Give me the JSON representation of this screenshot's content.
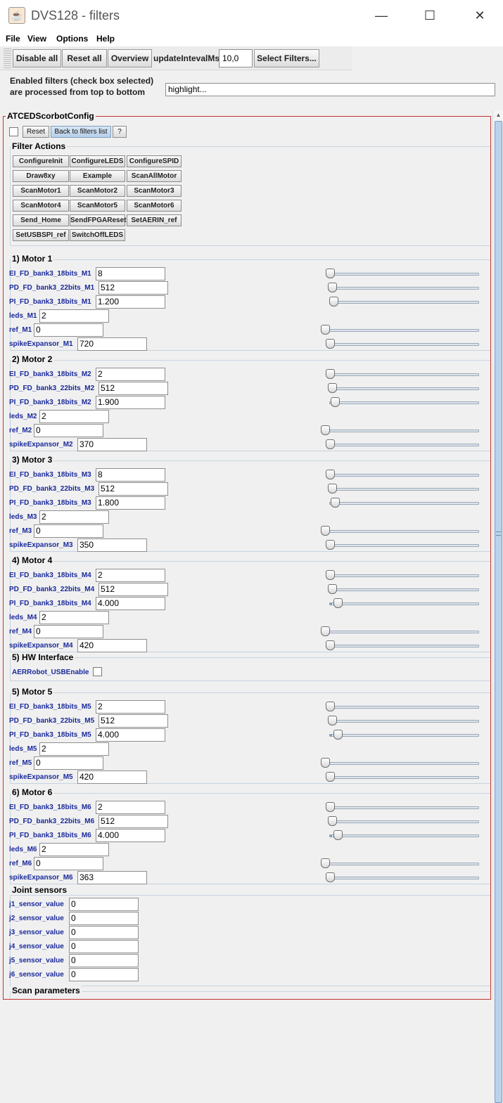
{
  "window": {
    "title": "DVS128 - filters",
    "minimize_glyph": "—",
    "maximize_glyph": "☐",
    "close_glyph": "✕",
    "app_icon": "java-cup-icon"
  },
  "menu": [
    "File",
    "View",
    "Options",
    "Help"
  ],
  "toolbar": {
    "disable_all": "Disable all",
    "reset_all": "Reset  all",
    "overview": "Overview",
    "update_label": "updateIntevalMs",
    "update_value": "10,0",
    "select_filters": "Select Filters..."
  },
  "info": {
    "line1": "Enabled filters (check box selected)",
    "line2": "are processed from top to bottom",
    "highlight_value": "highlight..."
  },
  "filter": {
    "name": "ATCEDScorbotConfig",
    "reset": "Reset",
    "back": "Back to filters list",
    "help": "?",
    "actions_title": "Filter Actions",
    "actions": [
      "ConfigureInit",
      "ConfigureLEDS",
      "ConfigureSPID",
      "Draw8xy",
      "Example",
      "ScanAllMotor",
      "ScanMotor1",
      "ScanMotor2",
      "ScanMotor3",
      "ScanMotor4",
      "ScanMotor5",
      "ScanMotor6",
      "Send_Home",
      "SendFPGAReset",
      "SetAERIN_ref",
      "SetUSBSPI_ref",
      "SwitchOffLEDS"
    ]
  },
  "motors": [
    {
      "title": "1) Motor 1",
      "params": [
        {
          "label": "EI_FD_bank3_18bits_M1",
          "value": "8",
          "slider": 0.0
        },
        {
          "label": "PD_FD_bank3_22bits_M1",
          "value": "512",
          "slider": 0.0
        },
        {
          "label": "PI_FD_bank3_18bits_M1",
          "value": "1.200",
          "slider": 0.0
        },
        {
          "label": "leds_M1",
          "value": "2"
        },
        {
          "label": "ref_M1",
          "value": "0",
          "slider": 0.0
        },
        {
          "label": "spikeExpansor_M1",
          "value": "720",
          "slider": 0.0
        }
      ]
    },
    {
      "title": "2) Motor 2",
      "params": [
        {
          "label": "EI_FD_bank3_18bits_M2",
          "value": "2",
          "slider": 0.0
        },
        {
          "label": "PD_FD_bank3_22bits_M2",
          "value": "512",
          "slider": 0.0
        },
        {
          "label": "PI_FD_bank3_18bits_M2",
          "value": "1.900",
          "slider": 0.01
        },
        {
          "label": "leds_M2",
          "value": "2"
        },
        {
          "label": "ref_M2",
          "value": "0",
          "slider": 0.0
        },
        {
          "label": "spikeExpansor_M2",
          "value": "370",
          "slider": 0.0
        }
      ]
    },
    {
      "title": "3) Motor 3",
      "params": [
        {
          "label": "EI_FD_bank3_18bits_M3",
          "value": "8",
          "slider": 0.0
        },
        {
          "label": "PD_FD_bank3_22bits_M3",
          "value": "512",
          "slider": 0.0
        },
        {
          "label": "PI_FD_bank3_18bits_M3",
          "value": "1.800",
          "slider": 0.01
        },
        {
          "label": "leds_M3",
          "value": "2"
        },
        {
          "label": "ref_M3",
          "value": "0",
          "slider": 0.0
        },
        {
          "label": "spikeExpansor_M3",
          "value": "350",
          "slider": 0.0
        }
      ]
    },
    {
      "title": "4) Motor 4",
      "params": [
        {
          "label": "EI_FD_bank3_18bits_M4",
          "value": "2",
          "slider": 0.0
        },
        {
          "label": "PD_FD_bank3_22bits_M4",
          "value": "512",
          "slider": 0.0
        },
        {
          "label": "PI_FD_bank3_18bits_M4",
          "value": "4.000",
          "slider": 0.03
        },
        {
          "label": "leds_M4",
          "value": "2"
        },
        {
          "label": "ref_M4",
          "value": "0",
          "slider": 0.0
        },
        {
          "label": "spikeExpansor_M4",
          "value": "420",
          "slider": 0.0
        }
      ]
    },
    {
      "title": "5) Motor 5",
      "params": [
        {
          "label": "EI_FD_bank3_18bits_M5",
          "value": "2",
          "slider": 0.0
        },
        {
          "label": "PD_FD_bank3_22bits_M5",
          "value": "512",
          "slider": 0.0
        },
        {
          "label": "PI_FD_bank3_18bits_M5",
          "value": "4.000",
          "slider": 0.03
        },
        {
          "label": "leds_M5",
          "value": "2"
        },
        {
          "label": "ref_M5",
          "value": "0",
          "slider": 0.0
        },
        {
          "label": "spikeExpansor_M5",
          "value": "420",
          "slider": 0.0
        }
      ]
    },
    {
      "title": "6) Motor 6",
      "params": [
        {
          "label": "EI_FD_bank3_18bits_M6",
          "value": "2",
          "slider": 0.0
        },
        {
          "label": "PD_FD_bank3_22bits_M6",
          "value": "512",
          "slider": 0.0
        },
        {
          "label": "PI_FD_bank3_18bits_M6",
          "value": "4.000",
          "slider": 0.03
        },
        {
          "label": "leds_M6",
          "value": "2"
        },
        {
          "label": "ref_M6",
          "value": "0",
          "slider": 0.0
        },
        {
          "label": "spikeExpansor_M6",
          "value": "363",
          "slider": 0.0
        }
      ]
    }
  ],
  "hw": {
    "title": "5) HW Interface",
    "label": "AERRobot_USBEnable"
  },
  "joints": {
    "title": "Joint sensors",
    "params": [
      {
        "label": "j1_sensor_value",
        "value": "0"
      },
      {
        "label": "j2_sensor_value",
        "value": "0"
      },
      {
        "label": "j3_sensor_value",
        "value": "0"
      },
      {
        "label": "j4_sensor_value",
        "value": "0"
      },
      {
        "label": "j5_sensor_value",
        "value": "0"
      },
      {
        "label": "j6_sensor_value",
        "value": "0"
      }
    ]
  },
  "scan": {
    "title": "Scan parameters"
  },
  "scrollbar": {
    "up": "▲",
    "down": "▼"
  }
}
